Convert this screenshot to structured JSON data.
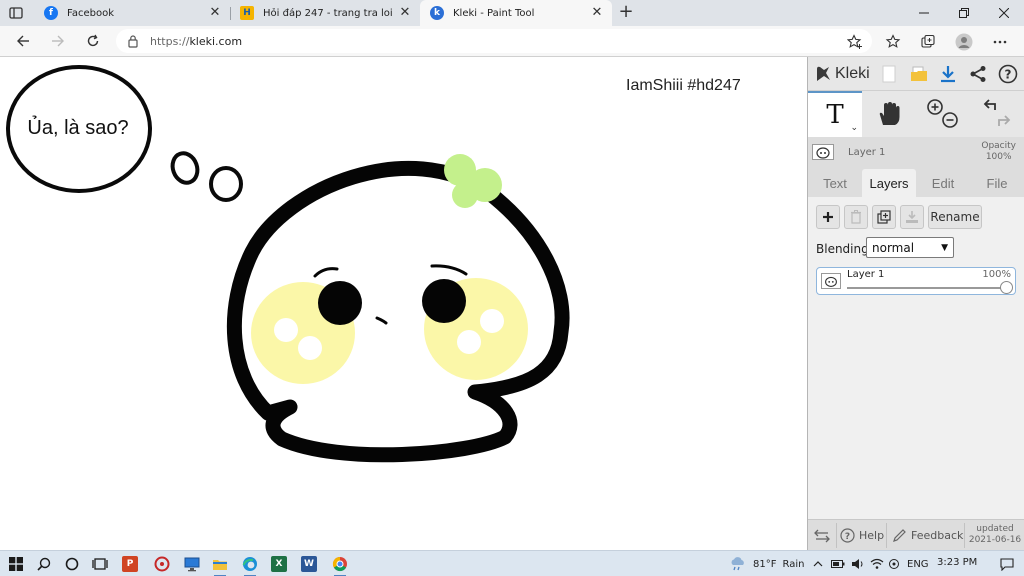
{
  "browser": {
    "tabs": [
      {
        "title": "Facebook",
        "favicon": "facebook-icon",
        "color": "#1877f2"
      },
      {
        "title": "Hỏi đáp 247 - trang tra loi",
        "favicon": "hoidap247-icon",
        "color": "#f5b400"
      },
      {
        "title": "Kleki - Paint Tool",
        "favicon": "kleki-icon",
        "color": "#2b6fd6"
      }
    ],
    "url_protocol": "https://",
    "url_host": "kleki.com"
  },
  "canvas": {
    "bubble_text": "Ủa, là sao?",
    "signature": "IamShiii #hd247"
  },
  "panel": {
    "logo": "Kleki",
    "layer_name": "Layer 1",
    "opacity_label": "Opacity",
    "opacity_value": "100%",
    "tabs": [
      "Text",
      "Layers",
      "Edit",
      "File"
    ],
    "active_tab": "Layers",
    "rename_label": "Rename",
    "blending_label": "Blending",
    "blending_value": "normal",
    "layers": [
      {
        "name": "Layer 1",
        "opacity": "100%"
      }
    ],
    "help_label": "Help",
    "feedback_label": "Feedback",
    "updated_label": "updated",
    "updated_date": "2021-06-16"
  },
  "taskbar": {
    "weather": "81°F",
    "weather_text": "Rain",
    "language": "ENG",
    "time": "3:23 PM",
    "apps": [
      "search-icon",
      "cortana-icon",
      "task-view-icon",
      "powerpoint-icon",
      "app-red-icon",
      "monitor-icon",
      "file-explorer-icon",
      "edge-icon",
      "excel-icon",
      "word-icon",
      "chrome-icon"
    ]
  }
}
